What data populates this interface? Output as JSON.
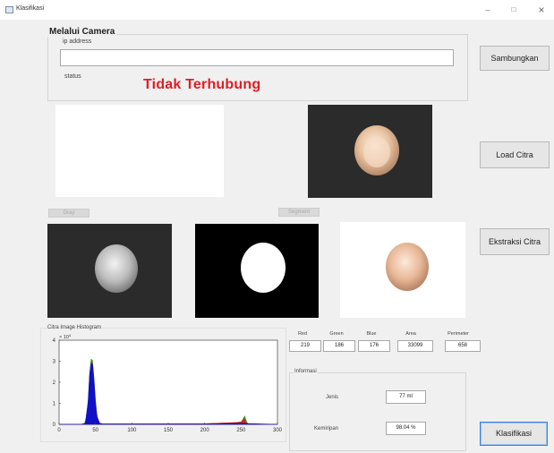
{
  "window": {
    "title": "Klasifikasi",
    "minimize": "–",
    "maximize": "□",
    "close": "×"
  },
  "camera_panel": {
    "title": "Melalui Camera",
    "ip_label": "ip address",
    "ip_value": "",
    "status_label": "status",
    "status_value": "Tidak Terhubung",
    "status_color": "#e21d23"
  },
  "buttons": {
    "connect": "Sambungkan",
    "load_image": "Load Citra",
    "extract_image": "Ekstraksi Citra",
    "classify": "Klasifikasi",
    "small_left": "Gray",
    "small_right": "Segment"
  },
  "features": [
    {
      "label": "Red",
      "value": "219"
    },
    {
      "label": "Green",
      "value": "186"
    },
    {
      "label": "Blue",
      "value": "176"
    },
    {
      "label": "Area",
      "value": "33099"
    },
    {
      "label": "Perimeter",
      "value": "658"
    }
  ],
  "info_panel": {
    "title": "Informasi",
    "type_label": "Jenis",
    "type_value": "77 ml",
    "accuracy_label": "Kemiripan",
    "accuracy_value": "98.04 %"
  },
  "histogram": {
    "title": "Citra Image Histogram",
    "exponent": "× 10",
    "exponent_power": "4"
  },
  "chart_data": {
    "type": "area",
    "title": "Citra Image Histogram",
    "xlabel": "",
    "ylabel": "",
    "xlim": [
      0,
      300
    ],
    "ylim": [
      0,
      4
    ],
    "y_scale_note": "× 10^4",
    "xticks": [
      "0",
      "50",
      "100",
      "150",
      "200",
      "250",
      "300"
    ],
    "yticks": [
      "0",
      "1",
      "2",
      "3",
      "4"
    ],
    "series": [
      {
        "color": "#1f9c1f",
        "x": [
          0,
          30,
          35,
          38,
          40,
          42,
          44,
          46,
          48,
          50,
          52,
          54,
          56,
          60,
          70,
          100,
          150,
          200,
          240,
          250,
          252,
          255,
          258,
          260,
          300
        ],
        "y": [
          0,
          0,
          0.05,
          0.4,
          1.2,
          2.4,
          3.1,
          3.05,
          2.2,
          1.2,
          0.5,
          0.15,
          0.05,
          0.02,
          0.02,
          0.02,
          0.02,
          0.03,
          0.08,
          0.12,
          0.2,
          0.4,
          0.1,
          0.02,
          0
        ]
      },
      {
        "color": "#d42020",
        "x": [
          0,
          30,
          36,
          40,
          42,
          44,
          46,
          48,
          50,
          52,
          56,
          60,
          100,
          200,
          250,
          254,
          256,
          260,
          300
        ],
        "y": [
          0,
          0,
          0.05,
          1.0,
          2.3,
          2.95,
          2.9,
          2.0,
          1.0,
          0.4,
          0.05,
          0.02,
          0.02,
          0.03,
          0.1,
          0.3,
          0.1,
          0.02,
          0
        ]
      },
      {
        "color": "#1010c8",
        "x": [
          0,
          30,
          36,
          40,
          42,
          44,
          46,
          48,
          50,
          52,
          56,
          60,
          100,
          200,
          250,
          300
        ],
        "y": [
          0,
          0,
          0.05,
          1.1,
          2.4,
          2.9,
          2.85,
          2.1,
          1.0,
          0.35,
          0.05,
          0.02,
          0.02,
          0.02,
          0.05,
          0
        ]
      }
    ]
  }
}
